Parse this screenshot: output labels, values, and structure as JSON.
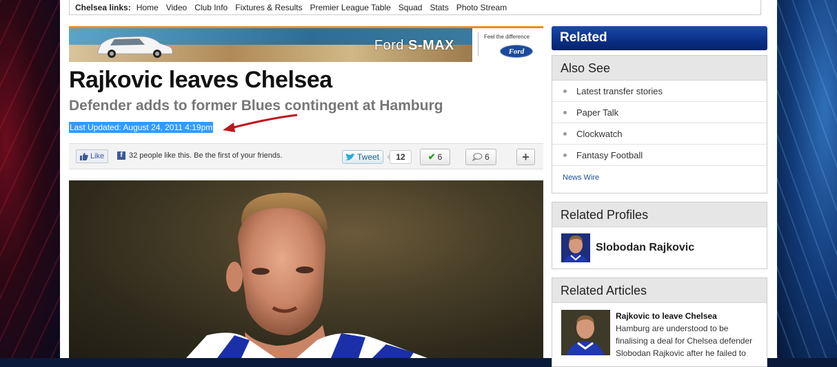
{
  "club_links": {
    "title": "Chelsea links:",
    "items": [
      "Home",
      "Video",
      "Club Info",
      "Fixtures & Results",
      "Premier League Table",
      "Squad",
      "Stats",
      "Photo Stream"
    ]
  },
  "advert": {
    "model_prefix": "Ford",
    "model_name": "S-MAX",
    "tagline": "Feel the difference",
    "brand": "Ford"
  },
  "article": {
    "headline": "Rajkovic leaves Chelsea",
    "subheadline": "Defender adds to former Blues contingent at Hamburg",
    "last_updated": "Last Updated: August 24, 2011 4:19pm"
  },
  "social": {
    "like_label": "Like",
    "like_text": "32 people like this. Be the first of your friends.",
    "tweet_label": "Tweet",
    "tweet_count": "12",
    "check_count": "6",
    "comment_count": "6",
    "plus_label": "+"
  },
  "sidebar": {
    "related_title": "Related",
    "also_see": {
      "title": "Also See",
      "items": [
        "Latest transfer stories",
        "Paper Talk",
        "Clockwatch",
        "Fantasy Football"
      ],
      "news_wire": "News Wire"
    },
    "related_profiles": {
      "title": "Related Profiles",
      "name": "Slobodan Rajkovic"
    },
    "related_articles": {
      "title": "Related Articles",
      "article_title": "Rajkovic to leave Chelsea",
      "article_snippet": "Hamburg are understood to be finalising a deal for Chelsea defender Slobodan Rajkovic after he failed to"
    }
  },
  "colors": {
    "selection_blue": "#3399ff",
    "related_blue": "#0a2f86",
    "advert_orange": "#f08a1e",
    "arrow_red": "#c0151c"
  }
}
